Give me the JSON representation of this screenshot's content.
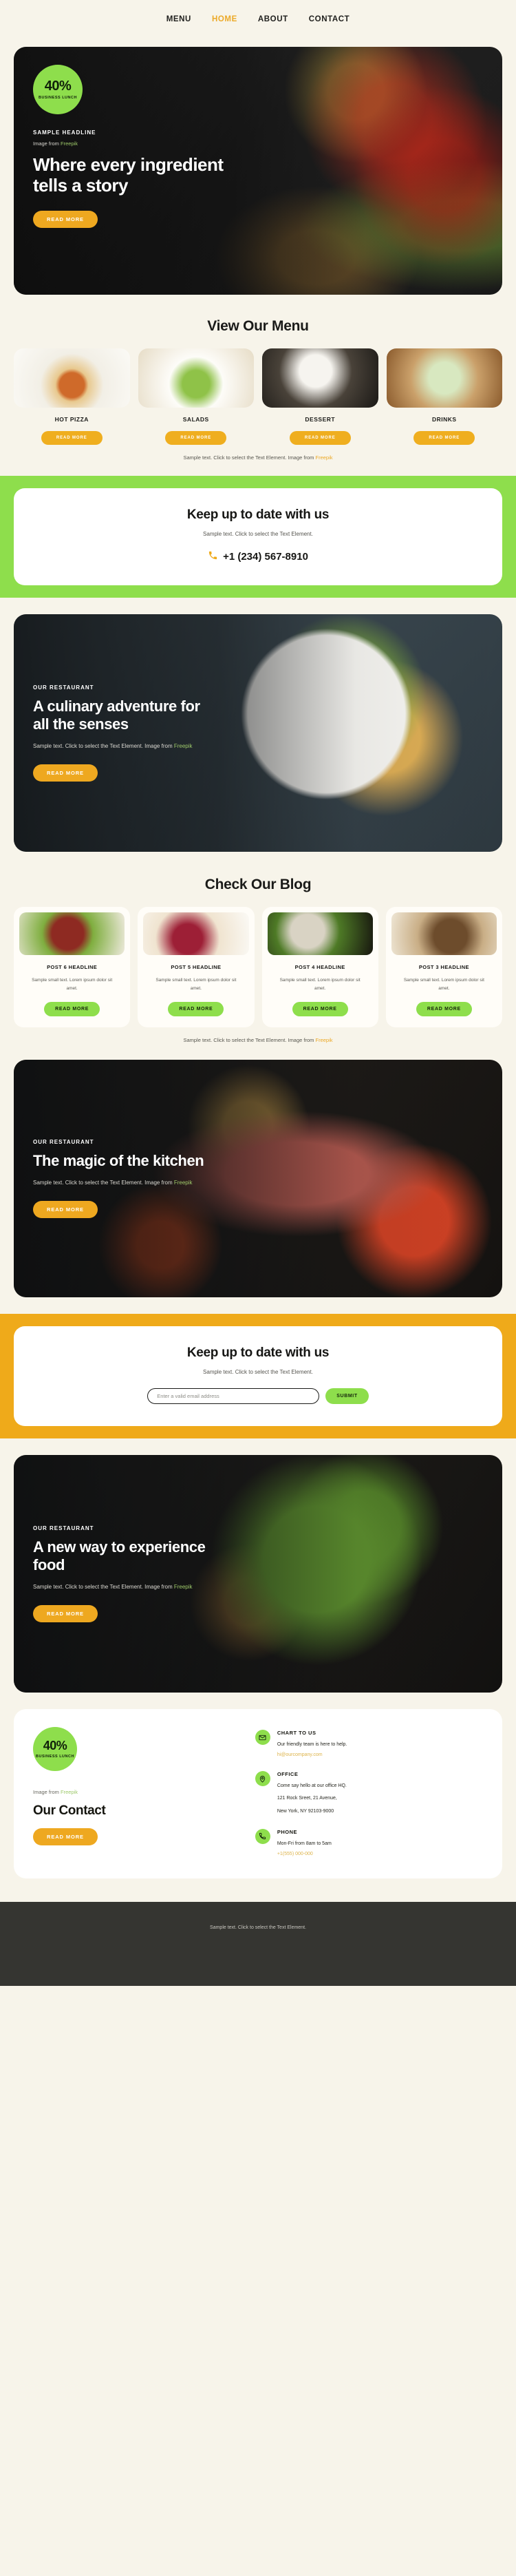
{
  "nav": {
    "items": [
      {
        "label": "MENU",
        "active": false
      },
      {
        "label": "HOME",
        "active": true
      },
      {
        "label": "ABOUT",
        "active": false
      },
      {
        "label": "CONTACT",
        "active": false
      }
    ]
  },
  "colors": {
    "page_bg": "#f7f4ea",
    "accent_green": "#8ede4c",
    "accent_amber": "#efaa1a",
    "nav_active": "#eca927",
    "footer_bg": "#353531"
  },
  "hero": {
    "badge_percent": "40%",
    "badge_label": "BUSINESS LUNCH",
    "eyebrow": "SAMPLE HEADLINE",
    "image_credit_prefix": "Image from ",
    "image_credit_link": "Freepik",
    "headline": "Where every ingredient tells a story",
    "button": "READ MORE"
  },
  "menu": {
    "title": "View Our Menu",
    "items": [
      {
        "label": "HOT PIZZA",
        "button": "READ MORE"
      },
      {
        "label": "SALADS",
        "button": "READ MORE"
      },
      {
        "label": "DESSERT",
        "button": "READ MORE"
      },
      {
        "label": "DRINKS",
        "button": "READ MORE"
      }
    ],
    "credit_text": "Sample text. Click to select the Text Element. Image from ",
    "credit_link": "Freepik"
  },
  "cta_phone": {
    "title": "Keep up to date with us",
    "subtitle": "Sample text. Click to select the Text Element.",
    "phone": "+1 (234) 567-8910",
    "phone_icon": "phone-icon"
  },
  "feature_salad": {
    "eyebrow": "OUR RESTAURANT",
    "headline": "A culinary adventure for all the senses",
    "text": "Sample text. Click to select the Text Element. Image from ",
    "text_link": "Freepik",
    "button": "READ MORE"
  },
  "blog": {
    "title": "Check Our Blog",
    "posts": [
      {
        "title": "POST 6 HEADLINE",
        "text": "Sample small text. Lorem ipsum dolor sit amet.",
        "button": "READ MORE"
      },
      {
        "title": "POST 5 HEADLINE",
        "text": "Sample small text. Lorem ipsum dolor sit amet.",
        "button": "READ MORE"
      },
      {
        "title": "POST 4 HEADLINE",
        "text": "Sample small text. Lorem ipsum dolor sit amet.",
        "button": "READ MORE"
      },
      {
        "title": "POST 3 HEADLINE",
        "text": "Sample small text. Lorem ipsum dolor sit amet.",
        "button": "READ MORE"
      }
    ],
    "credit_text": "Sample text. Click to select the Text Element. Image from ",
    "credit_link": "Freepik"
  },
  "feature_steak": {
    "eyebrow": "OUR RESTAURANT",
    "headline": "The magic of the kitchen",
    "text": "Sample text. Click to select the Text Element. Image from ",
    "text_link": "Freepik",
    "button": "READ MORE"
  },
  "newsletter": {
    "title": "Keep up to date with us",
    "subtitle": "Sample text. Click to select the Text Element.",
    "input_placeholder": "Enter a valid email address",
    "input_value": "",
    "submit": "SUBMIT"
  },
  "feature_bowl": {
    "eyebrow": "OUR RESTAURANT",
    "headline": "A new way to experience food",
    "text": "Sample text. Click to select the Text Element. Image from ",
    "text_link": "Freepik",
    "button": "READ MORE"
  },
  "contact": {
    "badge_percent": "40%",
    "badge_label": "BUSINESS LUNCH",
    "image_credit_prefix": "Image from ",
    "image_credit_link": "Freepik",
    "title": "Our Contact",
    "button": "READ MORE",
    "items": [
      {
        "icon": "mail-icon",
        "title": "CHART TO US",
        "line1": "Our friendly team is here to help.",
        "line2": "",
        "accent": "hi@ourcompany.com"
      },
      {
        "icon": "location-pin-icon",
        "title": "OFFICE",
        "line1": "Come say hello at our office HQ.",
        "line2": "121 Rock Sreet, 21 Avenue,",
        "line3": "New York, NY 92103-9000",
        "accent": ""
      },
      {
        "icon": "phone-icon",
        "title": "PHONE",
        "line1": "Mon-Fri from 8am to 5am",
        "line2": "",
        "accent": "+1(555) 000-000"
      }
    ]
  },
  "footer": {
    "text": "Sample text. Click to select the Text Element."
  }
}
